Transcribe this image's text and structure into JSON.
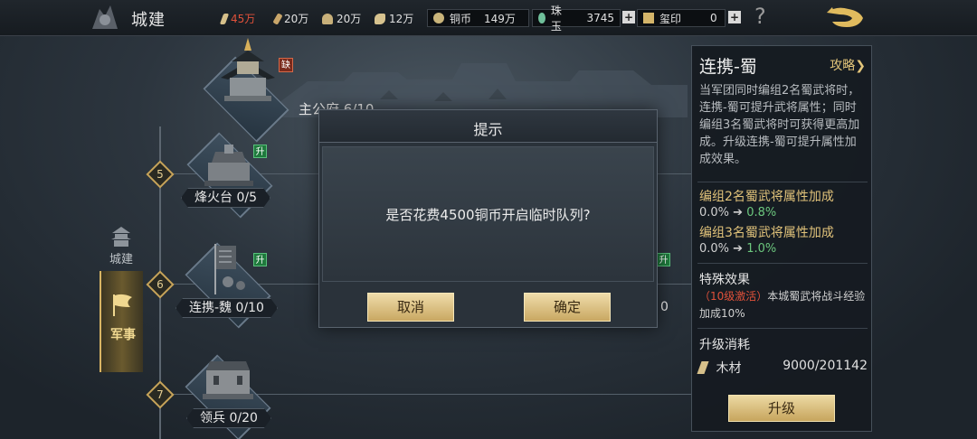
{
  "header": {
    "title": "城建",
    "resources": [
      {
        "icon": "food-icon",
        "value": "45万",
        "warning": true
      },
      {
        "icon": "wood-icon",
        "value": "20万",
        "warning": false
      },
      {
        "icon": "stone-icon",
        "value": "20万",
        "warning": false
      },
      {
        "icon": "iron-icon",
        "value": "12万",
        "warning": false
      }
    ],
    "currencies": [
      {
        "icon": "copper-coin-icon",
        "label": "铜币",
        "value": "149万"
      },
      {
        "icon": "jade-icon",
        "label": "珠玉",
        "value": "3745"
      },
      {
        "icon": "seal-icon",
        "label": "玺印",
        "value": "0"
      }
    ],
    "plus": "+",
    "help": "?"
  },
  "nav": {
    "city_label": "城建",
    "military_label": "军事"
  },
  "buildings": {
    "main": {
      "label": "主公府 6/10",
      "badge": "缺"
    },
    "b5": {
      "level": "5",
      "label": "烽火台 0/5",
      "badge": "升"
    },
    "b6": {
      "level": "6",
      "label": "连携-魏 0/10",
      "badge": "升"
    },
    "b6r": {
      "label": "0",
      "badge": "升"
    },
    "b7": {
      "level": "7",
      "label": "领兵 0/20"
    }
  },
  "panel": {
    "title": "连携-蜀",
    "guide": "攻略",
    "description": "当军团同时编组2名蜀武将时，连携-蜀可提升武将属性；同时编组3名蜀武将时可获得更高加成。升级连携-蜀可提升属性加成效果。",
    "bonus2_head": "编组2名蜀武将属性加成",
    "bonus2_old": "0.0%",
    "bonus2_new": "0.8%",
    "bonus3_head": "编组3名蜀武将属性加成",
    "bonus3_old": "0.0%",
    "bonus3_new": "1.0%",
    "arrow": "➔",
    "special_head": "特殊效果",
    "special_cond": "（10级激活）",
    "special_text": "本城蜀武将战斗经验加成10%",
    "cost_head": "升级消耗",
    "cost_label": "木材",
    "cost_value": "9000/201142",
    "upgrade_label": "升级"
  },
  "dialog": {
    "title": "提示",
    "message": "是否花费4500铜币开启临时队列?",
    "cancel": "取消",
    "confirm": "确定"
  },
  "colors": {
    "accent_gold": "#d8b464",
    "warning_red": "#e0513a",
    "increase_green": "#6cc77e",
    "upgrade_badge": "#1f7a3d"
  }
}
